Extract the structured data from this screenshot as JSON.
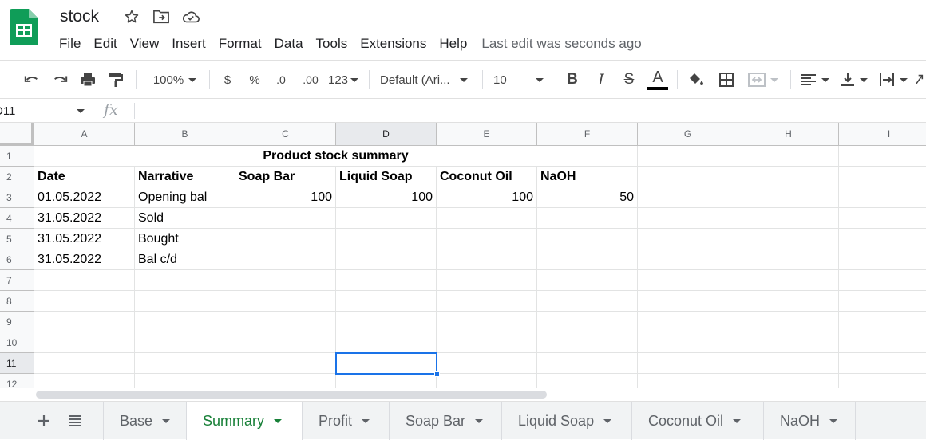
{
  "app": {
    "title": "stock",
    "menus": [
      "File",
      "Edit",
      "View",
      "Insert",
      "Format",
      "Data",
      "Tools",
      "Extensions",
      "Help"
    ],
    "last_edit": "Last edit was seconds ago"
  },
  "toolbar": {
    "zoom": "100%",
    "currency": "$",
    "percent": "%",
    "decrease_decimal": ".0",
    "increase_decimal": ".00",
    "more_formats": "123",
    "font": "Default (Ari...",
    "font_size": "10",
    "bold": "B",
    "italic": "I",
    "strike": "S",
    "text_color_letter": "A",
    "text_color": "#000000"
  },
  "formula_bar": {
    "name_box": "D11",
    "fx": "fx",
    "value": ""
  },
  "grid": {
    "columns": [
      "A",
      "B",
      "C",
      "D",
      "E",
      "F",
      "G",
      "H",
      "I"
    ],
    "selected_column": "D",
    "rows": [
      "1",
      "2",
      "3",
      "4",
      "5",
      "6",
      "7",
      "8",
      "9",
      "10",
      "11",
      "12"
    ],
    "selected_row": "11",
    "merged_title": "Product stock summary",
    "headers": [
      "Date",
      "Narrative",
      "Soap Bar",
      "Liquid Soap",
      "Coconut Oil",
      "NaOH"
    ],
    "data_rows": [
      {
        "date": "01.05.2022",
        "narrative": "Opening bal",
        "soap_bar": "100",
        "liquid_soap": "100",
        "coconut_oil": "100",
        "naoh": "50"
      },
      {
        "date": "31.05.2022",
        "narrative": "Sold",
        "soap_bar": "",
        "liquid_soap": "",
        "coconut_oil": "",
        "naoh": ""
      },
      {
        "date": "31.05.2022",
        "narrative": "Bought",
        "soap_bar": "",
        "liquid_soap": "",
        "coconut_oil": "",
        "naoh": ""
      },
      {
        "date": "31.05.2022",
        "narrative": "Bal c/d",
        "soap_bar": "",
        "liquid_soap": "",
        "coconut_oil": "",
        "naoh": ""
      }
    ]
  },
  "sheet_tabs": {
    "tabs": [
      "Base",
      "Summary",
      "Profit",
      "Soap Bar",
      "Liquid Soap",
      "Coconut Oil",
      "NaOH"
    ],
    "active": "Summary"
  },
  "colors": {
    "accent_green": "#188038",
    "selection_blue": "#1a73e8",
    "sheets_logo_green": "#0f9d58"
  }
}
